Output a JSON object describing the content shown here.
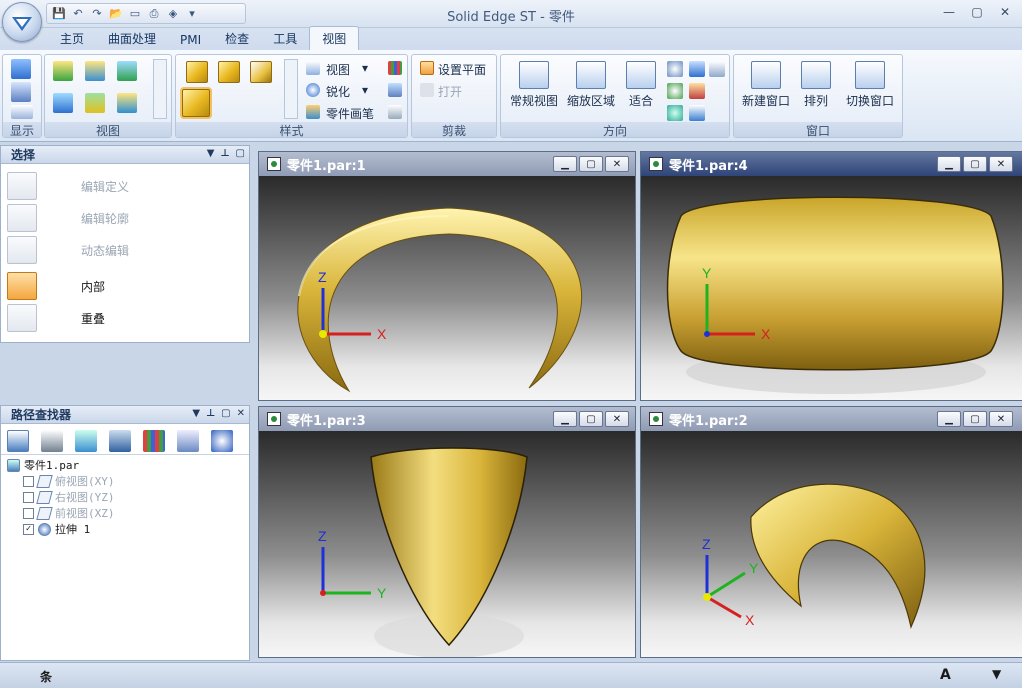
{
  "window": {
    "title": "Solid Edge ST - 零件",
    "minimize": "—",
    "restore": "▢",
    "close": "✕"
  },
  "tabs": [
    "主页",
    "曲面处理",
    "PMI",
    "检查",
    "工具",
    "视图"
  ],
  "active_tab": "视图",
  "ribbon": {
    "display_group": "显示",
    "view_group": "视图",
    "style_group": "样式",
    "style_items": {
      "view": "视图",
      "sharpen": "锐化",
      "part_painter": "零件画笔"
    },
    "clip_group": "剪裁",
    "clip_items": {
      "set_plane": "设置平面",
      "open": "打开"
    },
    "orient_group": "方向",
    "orient_items": {
      "normal_view": "常规视图",
      "zoom_area": "缩放区域",
      "fit": "适合"
    },
    "window_group": "窗口",
    "window_items": {
      "new_window": "新建窗口",
      "arrange": "排列",
      "switch_window": "切换窗口"
    }
  },
  "select_panel": {
    "title": "选择",
    "items": [
      {
        "label": "编辑定义",
        "enabled": false
      },
      {
        "label": "编辑轮廓",
        "enabled": false
      },
      {
        "label": "动态编辑",
        "enabled": false
      },
      {
        "label": "内部",
        "enabled": true
      },
      {
        "label": "重叠",
        "enabled": true
      }
    ]
  },
  "pathfinder": {
    "title": "路径查找器",
    "root": "零件1.par",
    "items": [
      {
        "label": "俯视图(XY)",
        "checked": false,
        "enabled": false
      },
      {
        "label": "右视图(YZ)",
        "checked": false,
        "enabled": false
      },
      {
        "label": "前视图(XZ)",
        "checked": false,
        "enabled": false
      },
      {
        "label": "拉伸 1",
        "checked": true,
        "enabled": true
      }
    ]
  },
  "viewports": [
    {
      "title": "零件1.par:1",
      "axes": [
        "Z",
        "X"
      ]
    },
    {
      "title": "零件1.par:4",
      "axes": [
        "Y",
        "X"
      ]
    },
    {
      "title": "零件1.par:3",
      "axes": [
        "Z",
        "Y"
      ]
    },
    {
      "title": "零件1.par:2",
      "axes": [
        "Z",
        "Y",
        "X"
      ]
    }
  ],
  "status": {
    "left": "条",
    "right": "A"
  },
  "colors": {
    "gold": "#d9b53a",
    "axis_x": "#d62020",
    "axis_y": "#1fb31f",
    "axis_z": "#2030d8"
  }
}
